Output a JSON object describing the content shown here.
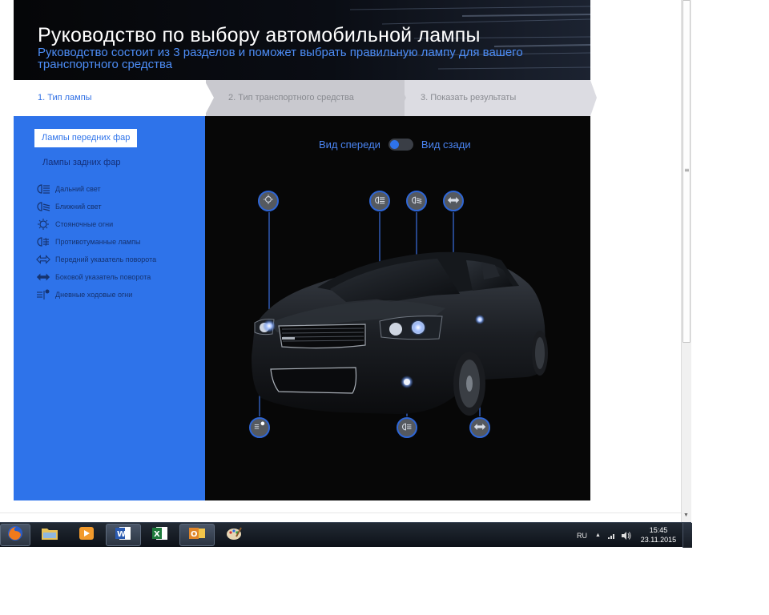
{
  "header": {
    "title": "Руководство по выбору автомобильной лампы",
    "subtitle": "Руководство состоит из 3 разделов и поможет выбрать правильную лампу для вашего транспортного средства"
  },
  "steps": [
    {
      "label": "1. Тип лампы"
    },
    {
      "label": "2. Тип транспортного средства"
    },
    {
      "label": "3. Показать результаты"
    }
  ],
  "left_panel": {
    "tab_front": "Лампы передних фар",
    "tab_rear": "Лампы задних фар",
    "legend": [
      {
        "label": "Дальний свет",
        "icon": "high-beam-icon"
      },
      {
        "label": "Ближний свет",
        "icon": "low-beam-icon"
      },
      {
        "label": "Стояночные огни",
        "icon": "parking-light-icon"
      },
      {
        "label": "Противотуманные лампы",
        "icon": "fog-light-icon"
      },
      {
        "label": "Передний указатель поворота",
        "icon": "front-turn-signal-icon"
      },
      {
        "label": "Боковой указатель поворота",
        "icon": "side-turn-signal-icon"
      },
      {
        "label": "Дневные ходовые огни",
        "icon": "daytime-running-light-icon"
      }
    ]
  },
  "view_toggle": {
    "front_label": "Вид спереди",
    "rear_label": "Вид сзади",
    "selected": "front"
  },
  "taskbar": {
    "language": "RU",
    "time": "15:45",
    "date": "23.11.2015",
    "apps": [
      "firefox",
      "explorer",
      "media-player",
      "word",
      "excel",
      "outlook",
      "paint"
    ]
  },
  "colors": {
    "accent": "#2e73ea",
    "header_bg": "#050608",
    "subtitle": "#4d8df6",
    "panel_dark": "#070707"
  }
}
